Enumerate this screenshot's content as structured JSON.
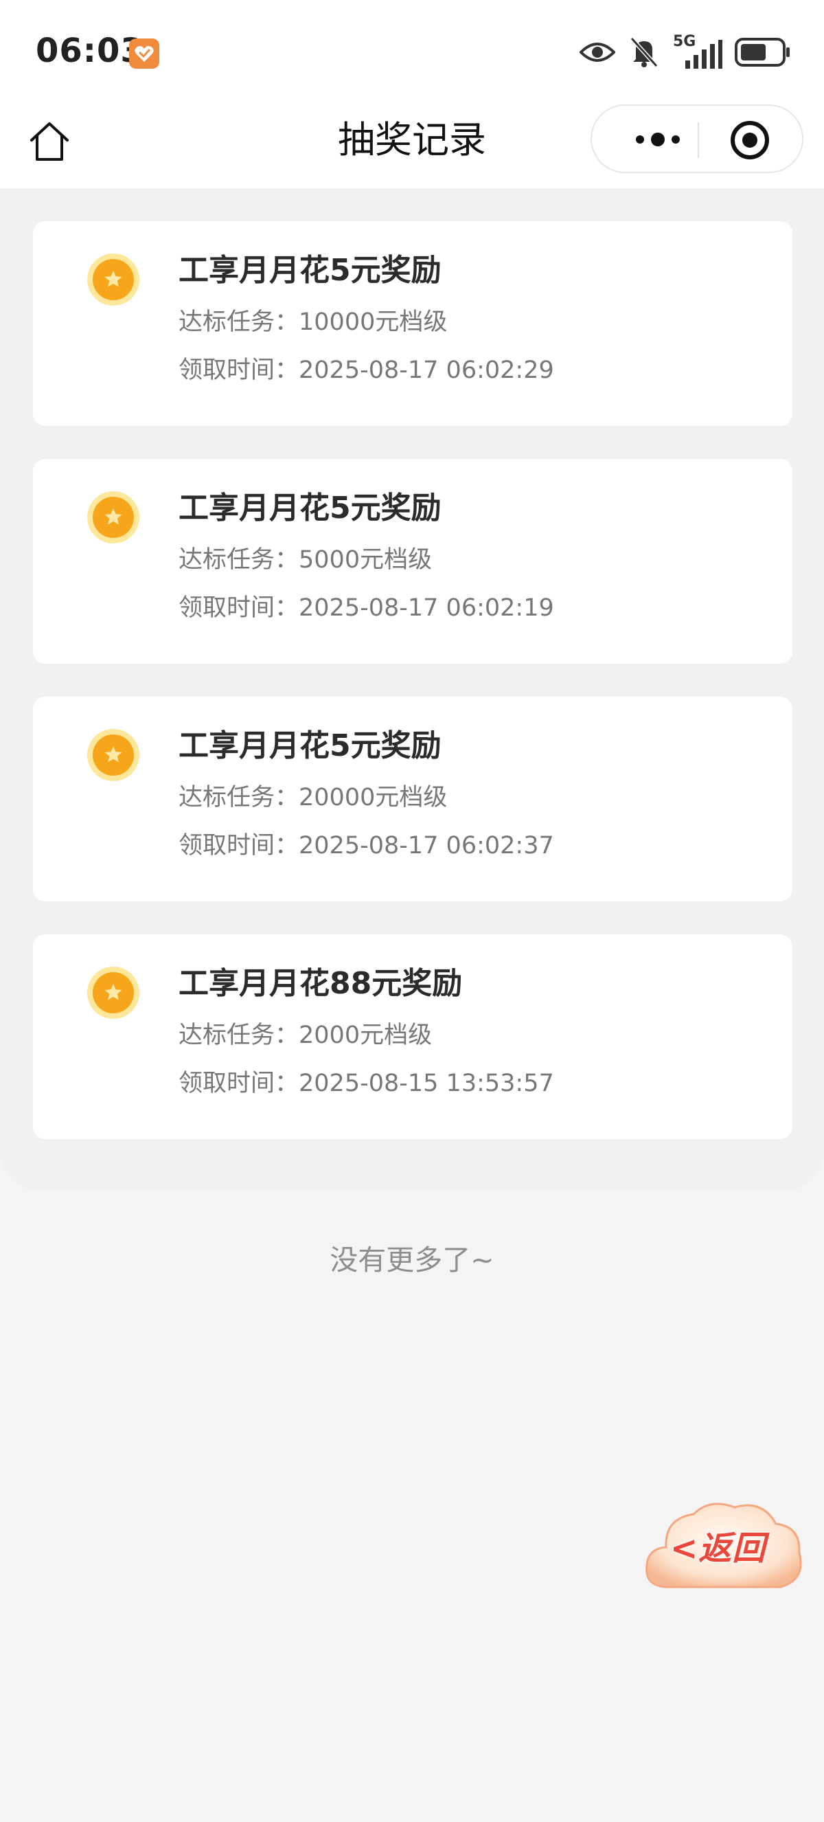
{
  "status_bar": {
    "time": "06:03",
    "network": "5G"
  },
  "nav": {
    "title": "抽奖记录"
  },
  "records": [
    {
      "title": "工享月月花5元奖励",
      "task_label": "达标任务：",
      "task_value": "10000元档级",
      "time_label": "领取时间：",
      "time_value": "2025-08-17 06:02:29"
    },
    {
      "title": "工享月月花5元奖励",
      "task_label": "达标任务：",
      "task_value": "5000元档级",
      "time_label": "领取时间：",
      "time_value": "2025-08-17 06:02:19"
    },
    {
      "title": "工享月月花5元奖励",
      "task_label": "达标任务：",
      "task_value": "20000元档级",
      "time_label": "领取时间：",
      "time_value": "2025-08-17 06:02:37"
    },
    {
      "title": "工享月月花88元奖励",
      "task_label": "达标任务：",
      "task_value": "2000元档级",
      "time_label": "领取时间：",
      "time_value": "2025-08-15 13:53:57"
    }
  ],
  "footer": {
    "no_more": "没有更多了~"
  },
  "float_button": {
    "label": "<返回"
  },
  "colors": {
    "accent_orange": "#f7a51b",
    "back_red": "#e8473a"
  },
  "icons": {
    "home": "home-icon",
    "more": "more-dots-icon",
    "close": "target-close-icon",
    "reward": "star-coin-icon"
  }
}
